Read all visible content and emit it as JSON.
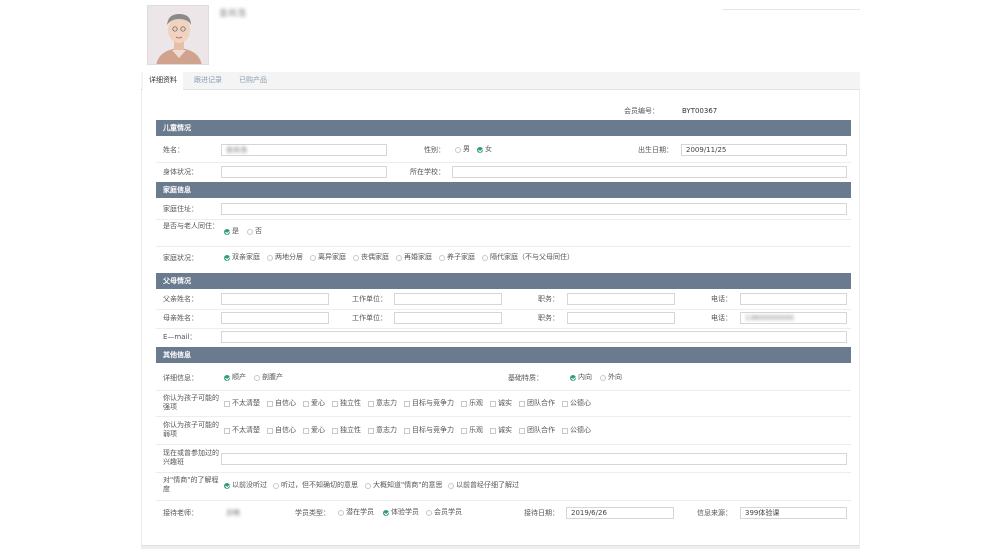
{
  "header": {
    "member_name": "金尚浩"
  },
  "tabs": [
    "详细资料",
    "跟进记录",
    "已购产品"
  ],
  "member_no": {
    "label": "会员编号：",
    "value": "BYT00367"
  },
  "sections": {
    "child": "儿童情况",
    "family": "家庭信息",
    "parents": "父母情况",
    "other": "其他信息"
  },
  "child": {
    "name_label": "姓名：",
    "name_value": "金尚浩",
    "gender_label": "性别：",
    "gender_options": [
      {
        "label": "男",
        "checked": false
      },
      {
        "label": "女",
        "checked": true
      }
    ],
    "birth_label": "出生日期：",
    "birth_value": "2009/11/25",
    "health_label": "身体状况：",
    "school_label": "所在学校："
  },
  "family": {
    "address_label": "家庭住址：",
    "elder_label": "是否与老人同住：",
    "elder_options": [
      {
        "label": "是",
        "checked": true
      },
      {
        "label": "否",
        "checked": false
      }
    ],
    "status_label": "家庭状况：",
    "status_options": [
      {
        "label": "双亲家庭",
        "checked": true
      },
      {
        "label": "两地分居",
        "checked": false
      },
      {
        "label": "离异家庭",
        "checked": false
      },
      {
        "label": "丧偶家庭",
        "checked": false
      },
      {
        "label": "再婚家庭",
        "checked": false
      },
      {
        "label": "养子家庭",
        "checked": false
      },
      {
        "label": "隔代家庭（不与父母同住）",
        "checked": false
      }
    ]
  },
  "parents": {
    "father_label": "父亲姓名：",
    "mother_label": "母亲姓名：",
    "work_label": "工作单位：",
    "title_label": "职务：",
    "phone_label": "电话：",
    "mother_phone_value": "13800000000",
    "email_label": "E—mail："
  },
  "other": {
    "detail_label": "详细信息：",
    "detail_options": [
      {
        "label": "顺产",
        "checked": true
      },
      {
        "label": "剖腹产",
        "checked": false
      }
    ],
    "temper_label": "基础特质：",
    "temper_options": [
      {
        "label": "内向",
        "checked": true
      },
      {
        "label": "外向",
        "checked": false
      }
    ],
    "strength_label": "你认为孩子可能的强项",
    "weakness_label": "你认为孩子可能的弱项",
    "traits": [
      "不太清楚",
      "自信心",
      "爱心",
      "独立性",
      "意志力",
      "目标与竞争力",
      "乐观",
      "诚实",
      "团队合作",
      "公德心"
    ],
    "interest_label": "现在或曾参加过的兴趣班",
    "qs_label": "对\"情商\"的了解程度",
    "qs_options": [
      {
        "label": "以前没听过",
        "checked": true
      },
      {
        "label": "听过，但不知确切的意思",
        "checked": false
      },
      {
        "label": "大概知道\"情商\"的意思",
        "checked": false
      },
      {
        "label": "以前曾经仔细了解过",
        "checked": false
      }
    ],
    "teacher_label": "接待老师：",
    "teacher_value": "苏畅",
    "student_type_label": "学员类型：",
    "student_type_options": [
      {
        "label": "潜在学员",
        "checked": false
      },
      {
        "label": "体验学员",
        "checked": true
      },
      {
        "label": "会员学员",
        "checked": false
      }
    ],
    "reception_date_label": "接待日期：",
    "reception_date_value": "2019/6/26",
    "source_label": "信息来源：",
    "source_value": "399体验课"
  },
  "colors": {
    "section_bar": "#6b7b8f",
    "accent": "#2e9c79"
  }
}
